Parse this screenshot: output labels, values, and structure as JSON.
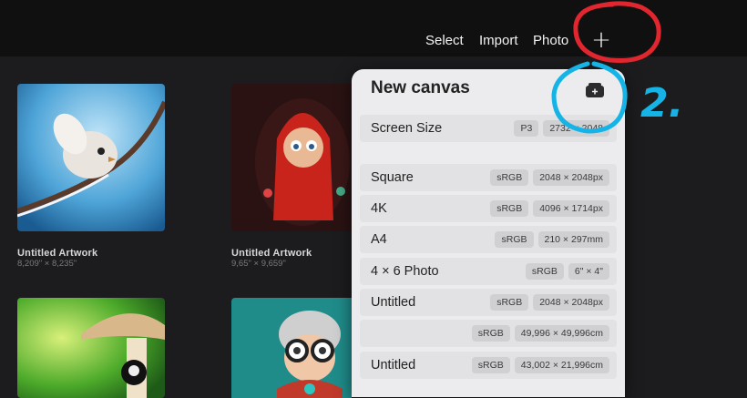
{
  "toolbar": {
    "select": "Select",
    "import": "Import",
    "photo": "Photo",
    "plus": "+"
  },
  "gallery": {
    "artworks": [
      {
        "title": "Untitled Artwork",
        "size": "8,209\" × 8,235\""
      },
      {
        "title": "Untitled Artwork",
        "size": "9,65\" × 9,659\""
      }
    ]
  },
  "popover": {
    "title": "New canvas",
    "rows": [
      {
        "name": "Screen Size",
        "color": "P3",
        "dims": "2732 × 2048"
      },
      {
        "name": "Square",
        "color": "sRGB",
        "dims": "2048 × 2048px"
      },
      {
        "name": "4K",
        "color": "sRGB",
        "dims": "4096 × 1714px"
      },
      {
        "name": "A4",
        "color": "sRGB",
        "dims": "210 × 297mm"
      },
      {
        "name": "4 × 6 Photo",
        "color": "sRGB",
        "dims": "6\" × 4\""
      },
      {
        "name": "Untitled",
        "color": "sRGB",
        "dims": "2048 × 2048px"
      },
      {
        "name": "",
        "color": "sRGB",
        "dims": "49,996 × 49,996cm"
      },
      {
        "name": "Untitled",
        "color": "sRGB",
        "dims": "43,002 × 21,996cm"
      }
    ]
  },
  "annotation": {
    "step_label": "2.",
    "colors": {
      "circle_1": "#e0262e",
      "circle_2": "#16b4e6"
    }
  }
}
